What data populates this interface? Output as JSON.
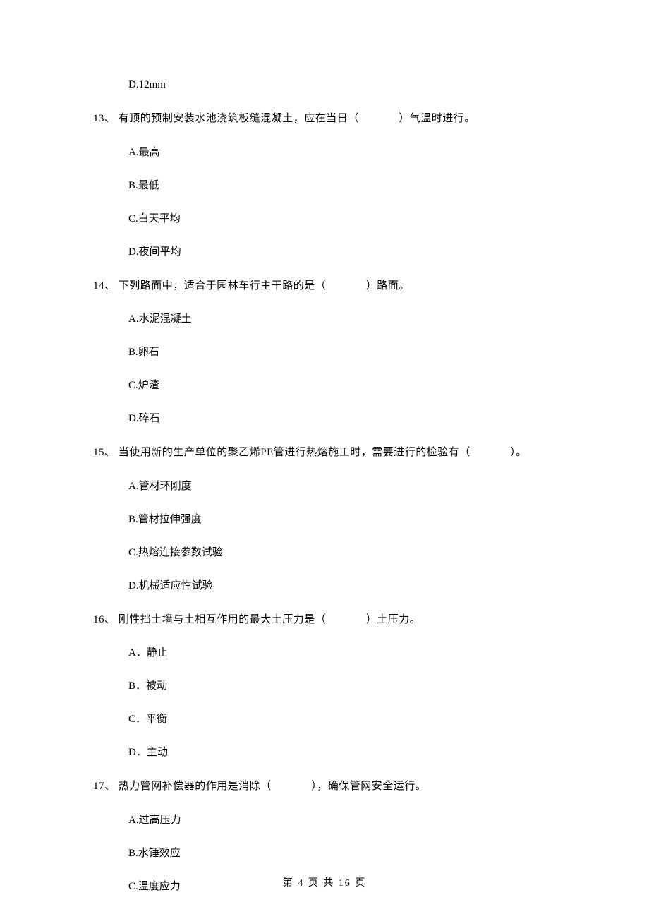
{
  "top_option": "D.12mm",
  "questions": [
    {
      "num": "13、",
      "pre": "有顶的预制安装水池浇筑板缝混凝土，应在当日（",
      "post": "）气温时进行。",
      "options": [
        "A.最高",
        "B.最低",
        "C.白天平均",
        "D.夜间平均"
      ]
    },
    {
      "num": "14、",
      "pre": "下列路面中，适合于园林车行主干路的是（",
      "post": "）路面。",
      "options": [
        "A.水泥混凝土",
        "B.卵石",
        "C.炉渣",
        "D.碎石"
      ]
    },
    {
      "num": "15、",
      "pre": "当使用新的生产单位的聚乙烯PE管进行热熔施工时，需要进行的检验有（",
      "post": "）。",
      "options": [
        "A.管材环刚度",
        "B.管材拉伸强度",
        "C.热熔连接参数试验",
        "D.机械适应性试验"
      ]
    },
    {
      "num": "16、",
      "pre": "刚性挡土墙与土相互作用的最大土压力是（",
      "post": "）土压力。",
      "options": [
        "A．静止",
        "B．被动",
        "C．平衡",
        "D．主动"
      ]
    },
    {
      "num": "17、",
      "pre": "热力管网补偿器的作用是消除（",
      "post": "），确保管网安全运行。",
      "options": [
        "A.过高压力",
        "B.水锤效应",
        "C.温度应力"
      ]
    }
  ],
  "footer": "第 4 页 共 16 页"
}
